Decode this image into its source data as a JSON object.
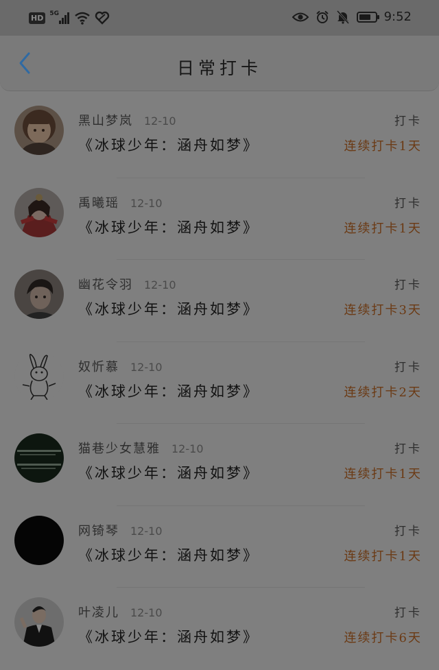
{
  "status_bar": {
    "hd": "HD",
    "network": "5G",
    "time": "9:52",
    "icons": [
      "hd-icon",
      "signal-icon",
      "wifi-icon",
      "heart-icon",
      "eye-icon",
      "alarm-icon",
      "mute-icon",
      "battery-icon"
    ]
  },
  "header": {
    "back_icon": "chevron-left-icon",
    "title": "日常打卡",
    "accent": "#2f6aa3"
  },
  "colors": {
    "streak": "#6b3a14",
    "overlay": "#7f7f7f"
  },
  "checkins": [
    {
      "name": "黑山梦岚",
      "date": "12-10",
      "book": "《冰球少年：涵舟如梦》",
      "action": "打卡",
      "streak": "连续打卡1天",
      "avatar": "girl-photo"
    },
    {
      "name": "禹曦瑶",
      "date": "12-10",
      "book": "《冰球少年：涵舟如梦》",
      "action": "打卡",
      "streak": "连续打卡1天",
      "avatar": "costume-photo"
    },
    {
      "name": "幽花令羽",
      "date": "12-10",
      "book": "《冰球少年：涵舟如梦》",
      "action": "打卡",
      "streak": "连续打卡3天",
      "avatar": "boy-photo"
    },
    {
      "name": "奴忻慕",
      "date": "12-10",
      "book": "《冰球少年：涵舟如梦》",
      "action": "打卡",
      "streak": "连续打卡2天",
      "avatar": "rabbit-sketch"
    },
    {
      "name": "猫巷少女慧雅",
      "date": "12-10",
      "book": "《冰球少年：涵舟如梦》",
      "action": "打卡",
      "streak": "连续打卡1天",
      "avatar": "text-card"
    },
    {
      "name": "网锜琴",
      "date": "12-10",
      "book": "《冰球少年：涵舟如梦》",
      "action": "打卡",
      "streak": "连续打卡1天",
      "avatar": "black-circle"
    },
    {
      "name": "叶凌儿",
      "date": "12-10",
      "book": "《冰球少年：涵舟如梦》",
      "action": "打卡",
      "streak": "连续打卡6天",
      "avatar": "suit-photo"
    }
  ]
}
